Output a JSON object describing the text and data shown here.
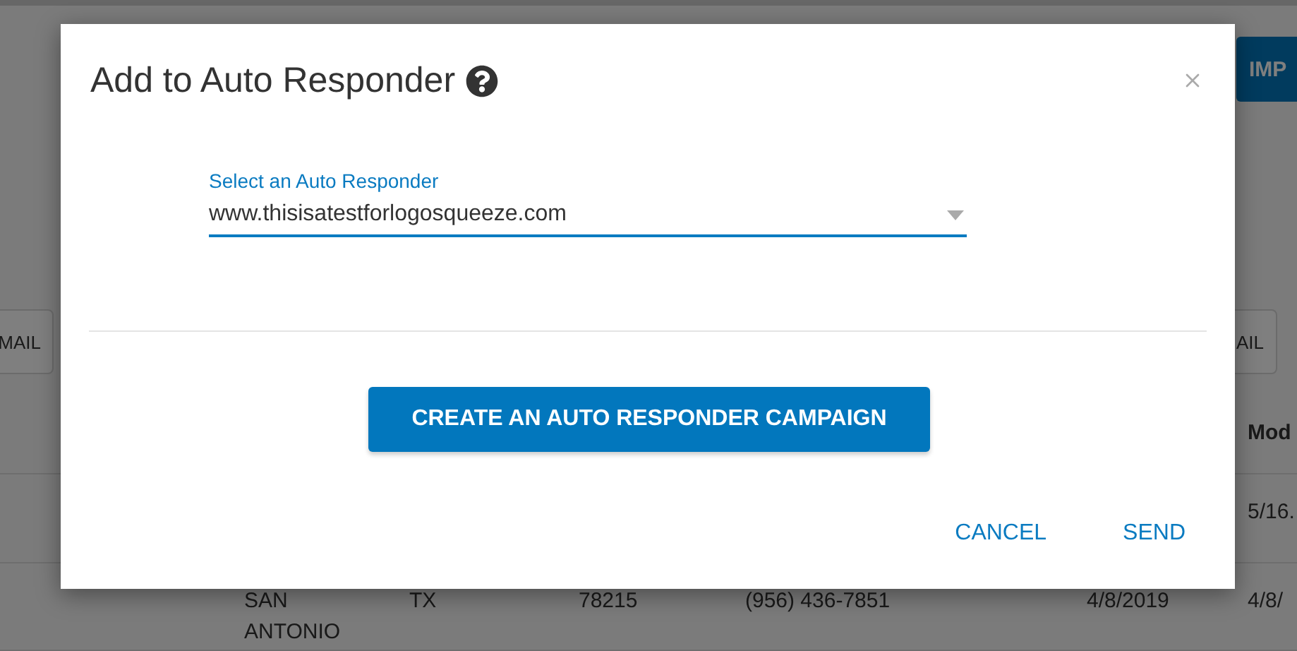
{
  "background_page": {
    "top_button": "IMP",
    "tabs": [
      {
        "label": "MAIL"
      },
      {
        "label": "AIL"
      }
    ],
    "table": {
      "column_header": "Mod",
      "rows": [
        {
          "visible_cells": [
            "5/16."
          ]
        },
        {
          "visible_cells": [
            "SAN ANTONIO",
            "TX",
            "78215",
            "(956) 436-7851",
            "4/8/2019",
            "4/8/"
          ]
        }
      ]
    }
  },
  "dialog": {
    "title": "Add to Auto Responder",
    "select": {
      "label": "Select an Auto Responder",
      "value": "www.thisisatestforlogosqueeze.com"
    },
    "create_button": "CREATE AN AUTO RESPONDER CAMPAIGN",
    "actions": [
      "CANCEL",
      "SEND"
    ]
  }
}
